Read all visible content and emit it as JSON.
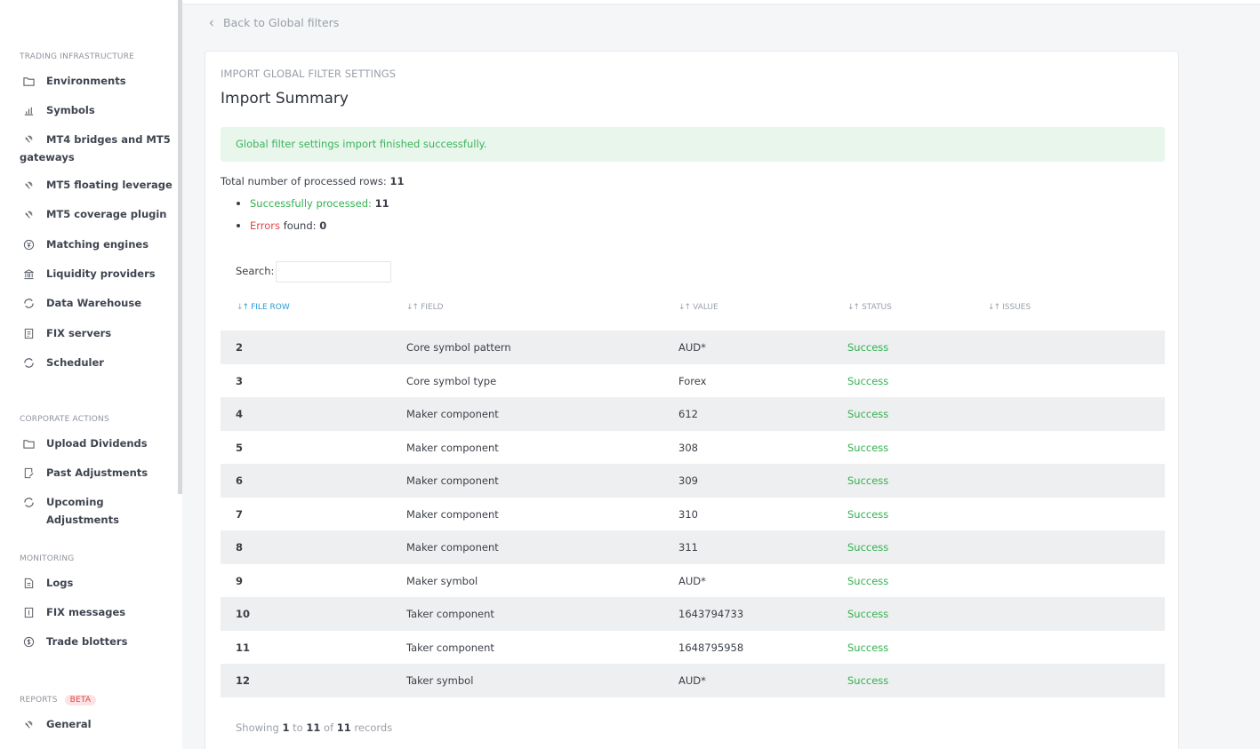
{
  "sidebar": {
    "sections": [
      {
        "title": "TRADING INFRASTRUCTURE"
      },
      {
        "title": "CORPORATE ACTIONS"
      },
      {
        "title": "MONITORING"
      },
      {
        "title": "REPORTS",
        "badge": "BETA"
      }
    ],
    "items": [
      {
        "label": "Environments",
        "icon": "folder-icon"
      },
      {
        "label": "Symbols",
        "icon": "bar-chart-icon"
      },
      {
        "label": "MT4 bridges and MT5 gateways",
        "icon": "link-icon"
      },
      {
        "label": "MT5 floating leverage",
        "icon": "link-icon"
      },
      {
        "label": "MT5 coverage plugin",
        "icon": "link-icon"
      },
      {
        "label": "Matching engines",
        "icon": "yen-coin-icon"
      },
      {
        "label": "Liquidity providers",
        "icon": "bank-icon"
      },
      {
        "label": "Data Warehouse",
        "icon": "refresh-icon"
      },
      {
        "label": "FIX servers",
        "icon": "fix-doc-icon"
      },
      {
        "label": "Scheduler",
        "icon": "refresh-icon"
      },
      {
        "label": "Upload Dividends",
        "icon": "folder-icon"
      },
      {
        "label": "Past Adjustments",
        "icon": "doc-edit-icon"
      },
      {
        "label": "Upcoming Adjustments",
        "icon": "refresh-icon"
      },
      {
        "label": "Logs",
        "icon": "doc-icon"
      },
      {
        "label": "FIX messages",
        "icon": "doc-icon"
      },
      {
        "label": "Trade blotters",
        "icon": "dollar-coin-icon"
      },
      {
        "label": "General",
        "icon": "link-icon"
      }
    ]
  },
  "back_link": "Back to Global filters",
  "card": {
    "eyebrow": "IMPORT GLOBAL FILTER SETTINGS",
    "title": "Import Summary",
    "alert": "Global filter settings import finished successfully.",
    "total_label": "Total number of processed rows:",
    "total_value": "11",
    "success_label": "Successfully processed:",
    "success_value": "11",
    "errors_label": "Errors",
    "errors_suffix": "found:",
    "errors_value": "0",
    "search_label": "Search:",
    "search_value": ""
  },
  "table": {
    "columns": [
      "FILE ROW",
      "FIELD",
      "VALUE",
      "STATUS",
      "ISSUES"
    ],
    "rows": [
      {
        "row": "2",
        "field": "Core symbol pattern",
        "value": "AUD*",
        "status": "Success",
        "issues": ""
      },
      {
        "row": "3",
        "field": "Core symbol type",
        "value": "Forex",
        "status": "Success",
        "issues": ""
      },
      {
        "row": "4",
        "field": "Maker component",
        "value": "612",
        "status": "Success",
        "issues": ""
      },
      {
        "row": "5",
        "field": "Maker component",
        "value": "308",
        "status": "Success",
        "issues": ""
      },
      {
        "row": "6",
        "field": "Maker component",
        "value": "309",
        "status": "Success",
        "issues": ""
      },
      {
        "row": "7",
        "field": "Maker component",
        "value": "310",
        "status": "Success",
        "issues": ""
      },
      {
        "row": "8",
        "field": "Maker component",
        "value": "311",
        "status": "Success",
        "issues": ""
      },
      {
        "row": "9",
        "field": "Maker symbol",
        "value": "AUD*",
        "status": "Success",
        "issues": ""
      },
      {
        "row": "10",
        "field": "Taker component",
        "value": "1643794733",
        "status": "Success",
        "issues": ""
      },
      {
        "row": "11",
        "field": "Taker component",
        "value": "1648795958",
        "status": "Success",
        "issues": ""
      },
      {
        "row": "12",
        "field": "Taker symbol",
        "value": "AUD*",
        "status": "Success",
        "issues": ""
      }
    ]
  },
  "footer": {
    "showing": "Showing",
    "from": "1",
    "to_word": "to",
    "to": "11",
    "of_word": "of",
    "total": "11",
    "records": "records"
  },
  "colors": {
    "success": "#32b150",
    "error": "#e04848",
    "accent": "#2d9bd6",
    "alert_bg": "#e8f6ec"
  }
}
